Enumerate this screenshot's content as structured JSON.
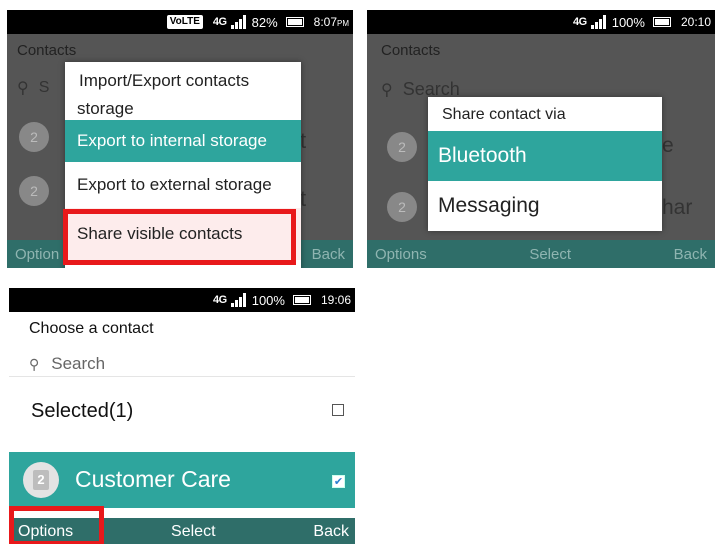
{
  "screen1": {
    "status": {
      "volte": "VoLTE",
      "network": "4G",
      "battery": "82%",
      "time": "8:07",
      "ampm": "PM"
    },
    "bg_title": "Contacts",
    "bg_search_partial": "S",
    "bg_row_letters": [
      "t",
      "t"
    ],
    "menu": {
      "header": "Import/Export contacts",
      "items": [
        "storage",
        "Export to internal storage",
        "Export to external storage",
        "Share visible contacts"
      ]
    },
    "softkeys": {
      "left": "Option",
      "right": "Back"
    }
  },
  "screen2": {
    "status": {
      "network": "4G",
      "battery": "100%",
      "time": "20:10"
    },
    "bg_title": "Contacts",
    "bg_search": "Search",
    "bg_row_tails": [
      "e",
      "har"
    ],
    "menu": {
      "header": "Share contact via",
      "items": [
        "Bluetooth",
        "Messaging"
      ]
    },
    "softkeys": {
      "left": "Options",
      "center": "Select",
      "right": "Back"
    }
  },
  "screen3": {
    "status": {
      "network": "4G",
      "battery": "100%",
      "time": "19:06"
    },
    "title": "Choose a contact",
    "search_placeholder": "Search",
    "selected_label": "Selected(1)",
    "contact": {
      "avatar": "2",
      "name": "Customer Care"
    },
    "softkeys": {
      "left": "Options",
      "center": "Select",
      "right": "Back"
    }
  },
  "colors": {
    "accent": "#2ea59d",
    "softkey_bar": "#2f6e69",
    "highlight_box": "#e8191b"
  }
}
